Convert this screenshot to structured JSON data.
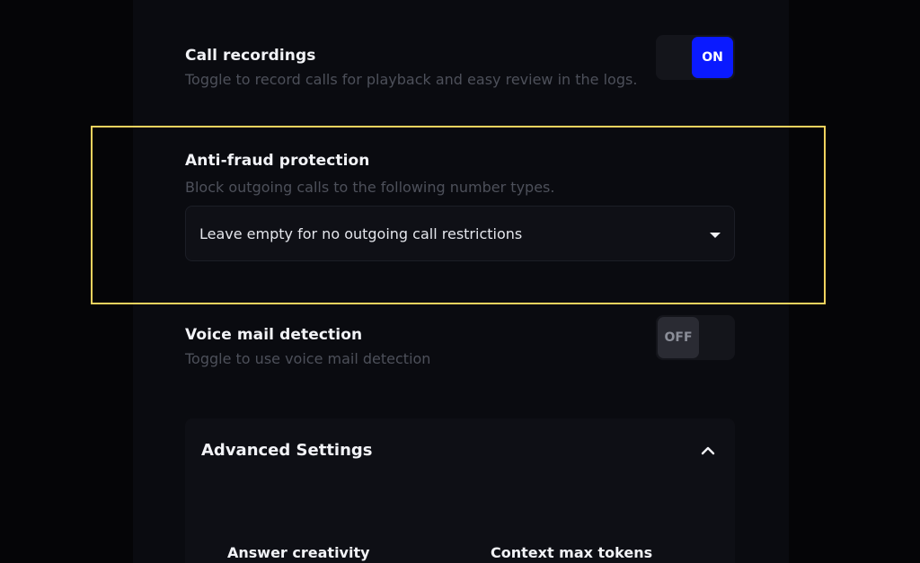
{
  "call_recordings": {
    "title": "Call recordings",
    "description": "Toggle to record calls for playback and easy review in the logs.",
    "toggle_label": "ON"
  },
  "anti_fraud": {
    "title": "Anti-fraud protection",
    "description": "Block outgoing calls to the following number types.",
    "select_value": "Leave empty for no outgoing call restrictions"
  },
  "voicemail": {
    "title": "Voice mail detection",
    "description": "Toggle to use voice mail detection",
    "toggle_label": "OFF"
  },
  "advanced": {
    "title": "Advanced Settings",
    "answer_creativity_label": "Answer creativity",
    "context_max_tokens_label": "Context max tokens"
  },
  "icons": {
    "select_caret": "caret-down-icon",
    "collapse": "chevron-up-icon"
  },
  "colors": {
    "accent": "#0a1aff",
    "highlight": "#f4d35e",
    "background": "#050507"
  }
}
